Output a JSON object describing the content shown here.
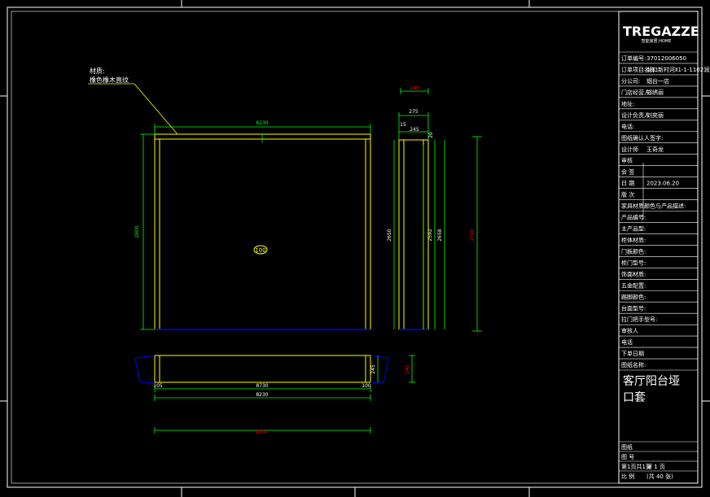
{
  "colors": {
    "background": "#000000",
    "frame": "#ffffff",
    "outline": "#ffff00",
    "dimension": "#00ff00",
    "section": "#0000ff",
    "callout": "#ffff00",
    "highlight": "#ff0000"
  },
  "logo": {
    "brand": "TREGAZZE",
    "subtitle": "智能家居·HOME"
  },
  "callout": {
    "line1": "材质:",
    "line2": "橡色橡木直纹"
  },
  "marker": {
    "text": "100"
  },
  "front_view": {
    "dims": {
      "width_top": "8230",
      "height_left": "2800"
    }
  },
  "side_view": {
    "dims": {
      "top_outer": "140",
      "top_inner": "275",
      "mid_a": "15",
      "mid_b": "245",
      "right_small": "20",
      "h1": "2650",
      "h2": "2592",
      "h3": "2658",
      "h4": "2780"
    }
  },
  "plan_view": {
    "dims": {
      "inner": "8730",
      "outer": "8230",
      "left_small": "105",
      "right_small": "100",
      "right_section": "245",
      "side": "245",
      "overall": "8390"
    }
  },
  "title_block": {
    "rows": [
      {
        "label": "订单编号:",
        "value": "37012006050"
      },
      {
        "label": "订单项目名称:",
        "value": "龙口新村河Ⅱ1-1-1102润润韵"
      },
      {
        "label": "分公司:",
        "value": "烟台一店"
      },
      {
        "label": "门店经营人:",
        "value": "郑绣丽"
      },
      {
        "label": "地址:",
        "value": ""
      },
      {
        "label": "设计负责人",
        "value": "刘奕丽"
      },
      {
        "label": "电话:",
        "value": ""
      },
      {
        "label": "图纸确认人签字:",
        "value": ""
      },
      {
        "label": "设计师",
        "value": "王奇龙"
      },
      {
        "label": "审核",
        "value": ""
      },
      {
        "label": "会 签",
        "value": ""
      },
      {
        "label": "日 期",
        "value": "2023.06.20"
      },
      {
        "label": "版 次",
        "value": ""
      },
      {
        "label": "家具材质颜色与产品描述:",
        "value": ""
      },
      {
        "label": "产品编号:",
        "value": ""
      },
      {
        "label": "主产品型:",
        "value": ""
      },
      {
        "label": "柜体材质:",
        "value": ""
      },
      {
        "label": "门板颜色:",
        "value": ""
      },
      {
        "label": "柜门型号:",
        "value": ""
      },
      {
        "label": "饰面材质:",
        "value": ""
      },
      {
        "label": "五金配置:",
        "value": ""
      },
      {
        "label": "踢脚颜色:",
        "value": ""
      },
      {
        "label": "台面型号:",
        "value": ""
      },
      {
        "label": "拉门把手型号:",
        "value": ""
      },
      {
        "label": "审核人",
        "value": ""
      },
      {
        "label": "电话",
        "value": ""
      },
      {
        "label": "下单日期",
        "value": ""
      },
      {
        "label": "图纸名称:",
        "value": ""
      }
    ],
    "drawing_name": "客厅阳台垭口套",
    "bottom_rows": [
      {
        "label": "图纸",
        "value": ""
      },
      {
        "label": "图 号",
        "value": ""
      },
      {
        "label": "第1页共1页",
        "value": "第 1 页"
      },
      {
        "label": "比 例",
        "value": "(共 40 张)"
      }
    ]
  }
}
